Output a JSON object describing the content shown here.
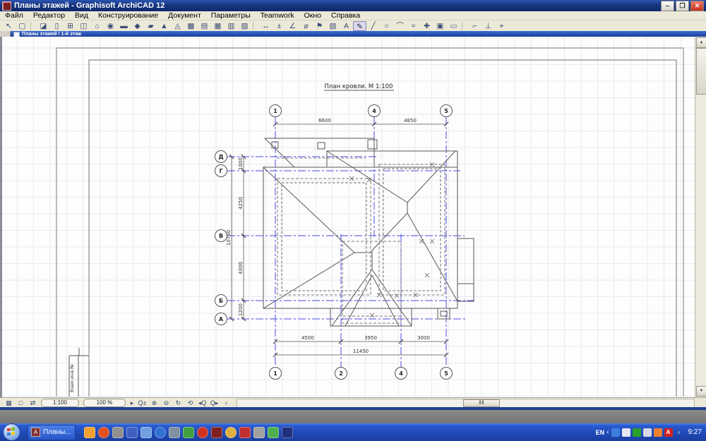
{
  "window": {
    "title": "Планы этажей - Graphisoft ArchiCAD 12",
    "minimize_glyph": "–",
    "maximize_glyph": "❐",
    "close_glyph": "✕"
  },
  "menu": [
    "Файл",
    "Редактор",
    "Вид",
    "Конструирование",
    "Документ",
    "Параметры",
    "Teamwork",
    "Окно",
    "Справка"
  ],
  "toolbar": {
    "icons": [
      {
        "name": "arrow-tool",
        "glyph": "↖"
      },
      {
        "name": "marquee-tool",
        "glyph": "▢"
      },
      {
        "name": "wall-tool",
        "glyph": "◪"
      },
      {
        "name": "door-tool",
        "glyph": "▯"
      },
      {
        "name": "window-tool",
        "glyph": "⊞"
      },
      {
        "name": "skylight-tool",
        "glyph": "◫"
      },
      {
        "name": "object-tool",
        "glyph": "⌂"
      },
      {
        "name": "lamp-tool",
        "glyph": "◉"
      },
      {
        "name": "slab-tool",
        "glyph": "▬"
      },
      {
        "name": "roof-tool",
        "glyph": "◆"
      },
      {
        "name": "shell-tool",
        "glyph": "▰"
      },
      {
        "name": "mesh-tool",
        "glyph": "▲"
      },
      {
        "name": "zone-tool",
        "glyph": "◬"
      },
      {
        "name": "curtain-wall-tool",
        "glyph": "▩"
      },
      {
        "name": "stair-tool",
        "glyph": "▤"
      },
      {
        "name": "beam-tool",
        "glyph": "▦"
      },
      {
        "name": "column-tool",
        "glyph": "▥"
      },
      {
        "name": "morph-tool",
        "glyph": "▧"
      },
      {
        "name": "dimension-tool",
        "glyph": "↔"
      },
      {
        "name": "level-dimension-tool",
        "glyph": "±"
      },
      {
        "name": "angle-dimension-tool",
        "glyph": "∠"
      },
      {
        "name": "radial-dimension-tool",
        "glyph": "⌀"
      },
      {
        "name": "label-tool",
        "glyph": "⚑"
      },
      {
        "name": "fill-tool",
        "glyph": "▨"
      },
      {
        "name": "text-tool",
        "glyph": "A"
      },
      {
        "name": "pen-tool",
        "glyph": "✎"
      },
      {
        "name": "line-tool",
        "glyph": "╱"
      },
      {
        "name": "circle-tool",
        "glyph": "○"
      },
      {
        "name": "arc-tool",
        "glyph": "⌒"
      },
      {
        "name": "spline-tool",
        "glyph": "≈"
      },
      {
        "name": "hotspot-tool",
        "glyph": "✚"
      },
      {
        "name": "figure-tool",
        "glyph": "▣"
      },
      {
        "name": "drawing-tool",
        "glyph": "▭"
      },
      {
        "name": "section-tool",
        "glyph": "⌐"
      },
      {
        "name": "elevation-tool",
        "glyph": "⊥"
      },
      {
        "name": "camera-tool",
        "glyph": "⌖"
      }
    ]
  },
  "child_window": {
    "title": "Планы этажей / 1-й этаж"
  },
  "drawing": {
    "title": "План кровли. М 1:100",
    "stamp": "Взам.инв.№",
    "axis_top": [
      "1",
      "4",
      "5"
    ],
    "axis_bottom": [
      "1",
      "2",
      "4",
      "5"
    ],
    "axis_left": [
      "Д",
      "Г",
      "В",
      "Б",
      "А"
    ],
    "dim_top": [
      "6600",
      "4850"
    ],
    "dim_bottom": [
      "4500",
      "3950",
      "3000"
    ],
    "dim_bottom_total": "11450",
    "dim_left": [
      "1000",
      "4250",
      "4300",
      "1200"
    ],
    "dim_left_total": "10750"
  },
  "statusbar": {
    "scale": "1:100",
    "zoom_level": "100 %",
    "left_icons": [
      {
        "name": "pet-palette-icon",
        "glyph": "▦"
      },
      {
        "name": "quick-options-icon",
        "glyph": "□"
      },
      {
        "name": "pan-icon",
        "glyph": "⇄"
      }
    ],
    "arrow_glyph": "▸",
    "zoom_icons": [
      {
        "name": "zoom-menu-icon",
        "glyph": "Q±"
      },
      {
        "name": "zoom-in-icon",
        "glyph": "⊕"
      },
      {
        "name": "zoom-out-icon",
        "glyph": "⊖"
      },
      {
        "name": "orbit-icon",
        "glyph": "↻"
      },
      {
        "name": "explore-icon",
        "glyph": "⟲"
      },
      {
        "name": "previous-zoom-icon",
        "glyph": "◂Q"
      },
      {
        "name": "next-zoom-icon",
        "glyph": "Q▸"
      },
      {
        "name": "scroll-left-icon",
        "glyph": "‹"
      }
    ]
  },
  "taskbar": {
    "task_label": "Планы...",
    "task_icon_letter": "A",
    "tray_lang": "EN",
    "tray_chevron": "‹",
    "clock": "9:27",
    "quicklaunch_colors": [
      "#f0a030",
      "#e05020",
      "#909090",
      "#4060c0",
      "#70a0e0",
      "#3070d0",
      "#8090a0",
      "#40a040",
      "#d03020",
      "#802020",
      "#e0b040",
      "#c03030",
      "#a0a0a0",
      "#50b050",
      "#203080"
    ],
    "tray_colors": [
      "#3d7edb",
      "#e6e6f0",
      "#2aa02a",
      "#d8d8e8",
      "#f08030",
      "#d42020"
    ]
  },
  "colors": {
    "titlebar_blue": "#17357f",
    "taskbar_blue": "#2a5ad0",
    "axis_line_blue": "#4a4ae0",
    "canvas_grid": "#e9e9f0",
    "close_button_red": "#c82d1c"
  }
}
